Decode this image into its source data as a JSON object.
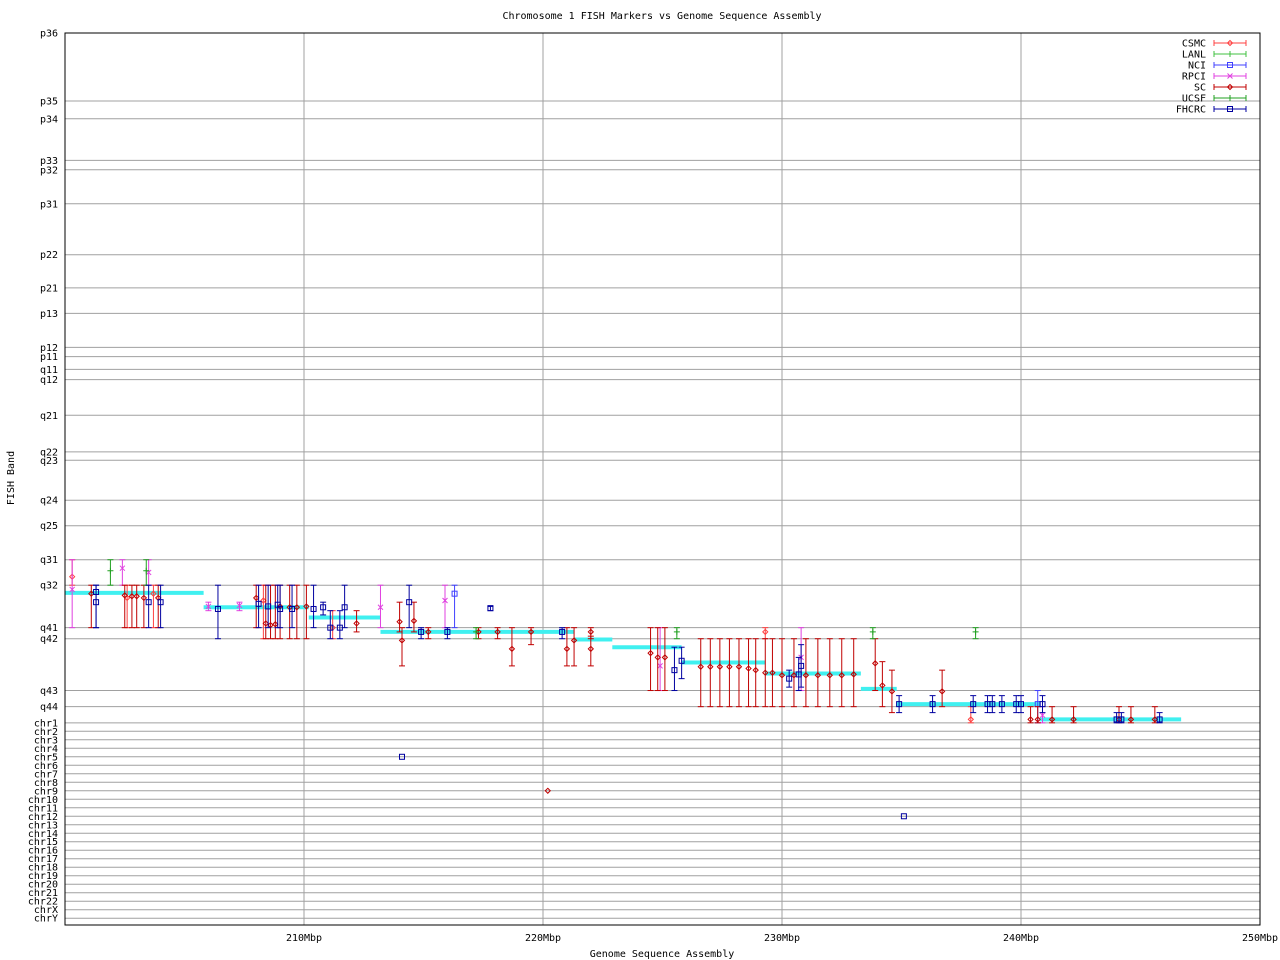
{
  "chart_data": {
    "type": "scatter",
    "title": "Chromosome 1 FISH Markers vs Genome Sequence Assembly",
    "xlabel": "Genome Sequence Assembly",
    "ylabel": "FISH Band",
    "xlim": [
      200,
      250
    ],
    "x_ticks": [
      {
        "value": 210,
        "label": "210Mbp"
      },
      {
        "value": 220,
        "label": "220Mbp"
      },
      {
        "value": 230,
        "label": "230Mbp"
      },
      {
        "value": 240,
        "label": "240Mbp"
      },
      {
        "value": 250,
        "label": "250Mbp"
      }
    ],
    "y_categories": [
      {
        "label": "p36",
        "pos": 0
      },
      {
        "label": "p35",
        "pos": 8.0
      },
      {
        "label": "p34",
        "pos": 10.1
      },
      {
        "label": "p33",
        "pos": 15.0
      },
      {
        "label": "p32",
        "pos": 16.1
      },
      {
        "label": "p31",
        "pos": 20.1
      },
      {
        "label": "p22",
        "pos": 26.1
      },
      {
        "label": "p21",
        "pos": 30.0
      },
      {
        "label": "p13",
        "pos": 33.0
      },
      {
        "label": "p12",
        "pos": 37.0
      },
      {
        "label": "p11",
        "pos": 38.1
      },
      {
        "label": "q11",
        "pos": 39.6
      },
      {
        "label": "q12",
        "pos": 40.8
      },
      {
        "label": "q21",
        "pos": 45.0
      },
      {
        "label": "q22",
        "pos": 49.3
      },
      {
        "label": "q23",
        "pos": 50.3
      },
      {
        "label": "q24",
        "pos": 55.0
      },
      {
        "label": "q25",
        "pos": 58.0
      },
      {
        "label": "q31",
        "pos": 62.0
      },
      {
        "label": "q32",
        "pos": 65.0
      },
      {
        "label": "q41",
        "pos": 70.0
      },
      {
        "label": "q42",
        "pos": 71.3
      },
      {
        "label": "q43",
        "pos": 77.4
      },
      {
        "label": "q44",
        "pos": 79.3
      },
      {
        "label": "chr1",
        "pos": 81.2
      },
      {
        "label": "chr2",
        "pos": 82.2
      },
      {
        "label": "chr3",
        "pos": 83.2
      },
      {
        "label": "chr4",
        "pos": 84.2
      },
      {
        "label": "chr5",
        "pos": 85.2
      },
      {
        "label": "chr6",
        "pos": 86.2
      },
      {
        "label": "chr7",
        "pos": 87.2
      },
      {
        "label": "chr8",
        "pos": 88.2
      },
      {
        "label": "chr9",
        "pos": 89.2
      },
      {
        "label": "chr10",
        "pos": 90.2
      },
      {
        "label": "chr11",
        "pos": 91.2
      },
      {
        "label": "chr12",
        "pos": 92.2
      },
      {
        "label": "chr13",
        "pos": 93.2
      },
      {
        "label": "chr14",
        "pos": 94.2
      },
      {
        "label": "chr15",
        "pos": 95.2
      },
      {
        "label": "chr16",
        "pos": 96.2
      },
      {
        "label": "chr17",
        "pos": 97.2
      },
      {
        "label": "chr18",
        "pos": 98.2
      },
      {
        "label": "chr19",
        "pos": 99.2
      },
      {
        "label": "chr20",
        "pos": 100.2
      },
      {
        "label": "chr21",
        "pos": 101.2
      },
      {
        "label": "chr22",
        "pos": 102.2
      },
      {
        "label": "chrX",
        "pos": 103.2
      },
      {
        "label": "chrY",
        "pos": 104.2
      }
    ],
    "ylim": [
      0,
      105
    ],
    "grid": true,
    "legend_position": "top-right",
    "assembly_segments": [
      {
        "x0": 200.0,
        "x1": 205.8,
        "y": 65.9
      },
      {
        "x0": 205.8,
        "x1": 210.2,
        "y": 67.6
      },
      {
        "x0": 210.2,
        "x1": 213.2,
        "y": 68.8
      },
      {
        "x0": 213.2,
        "x1": 221.3,
        "y": 70.5
      },
      {
        "x0": 221.3,
        "x1": 222.9,
        "y": 71.4
      },
      {
        "x0": 222.9,
        "x1": 225.8,
        "y": 72.3
      },
      {
        "x0": 225.8,
        "x1": 229.3,
        "y": 74.1
      },
      {
        "x0": 229.3,
        "x1": 233.3,
        "y": 75.4
      },
      {
        "x0": 233.3,
        "x1": 234.8,
        "y": 77.2
      },
      {
        "x0": 234.8,
        "x1": 240.8,
        "y": 79.0
      },
      {
        "x0": 240.8,
        "x1": 246.7,
        "y": 80.8
      }
    ],
    "series": [
      {
        "name": "CSMC",
        "color": "#ff4040",
        "marker": "diamond",
        "points": [
          [
            200.3,
            64.0,
            62.0,
            65.0
          ],
          [
            202.6,
            66.5,
            65.0,
            70.0
          ],
          [
            203.7,
            66.0,
            65.0,
            70.0
          ],
          [
            208.3,
            66.8,
            65.0,
            71.3
          ],
          [
            211.2,
            70.0,
            68.0,
            71.3
          ],
          [
            229.3,
            70.5,
            70.0,
            71.3
          ],
          [
            237.9,
            80.8,
            79.3,
            81.2
          ]
        ]
      },
      {
        "name": "LANL",
        "color": "#40c040",
        "marker": "plus",
        "points": []
      },
      {
        "name": "NCI",
        "color": "#4040ff",
        "marker": "square",
        "points": [
          [
            216.3,
            66.0,
            65.0,
            70.0
          ],
          [
            240.7,
            79.0,
            77.4,
            81.2
          ]
        ]
      },
      {
        "name": "RPCI",
        "color": "#e040e0",
        "marker": "cross",
        "points": [
          [
            200.3,
            65.5,
            62.0,
            70.0
          ],
          [
            202.4,
            63.0,
            62.0,
            65.0
          ],
          [
            203.5,
            63.5,
            62.0,
            65.0
          ],
          [
            206.0,
            67.5,
            67.0,
            68.0
          ],
          [
            207.3,
            67.4,
            67.0,
            68.0
          ],
          [
            213.2,
            67.6,
            65.0,
            70.0
          ],
          [
            215.9,
            66.8,
            65.0,
            70.0
          ],
          [
            224.9,
            74.5,
            70.0,
            77.4
          ],
          [
            230.8,
            73.5,
            70.0,
            77.4
          ],
          [
            240.9,
            80.3,
            79.3,
            81.2
          ]
        ]
      },
      {
        "name": "SC",
        "color": "#c00000",
        "marker": "diamond",
        "points": [
          [
            201.1,
            66.0,
            65.0,
            70.0
          ],
          [
            202.5,
            66.2,
            65.0,
            70.0
          ],
          [
            202.8,
            66.3,
            65.0,
            70.0
          ],
          [
            203.0,
            66.3,
            65.0,
            70.0
          ],
          [
            203.3,
            66.5,
            65.0,
            70.0
          ],
          [
            203.9,
            66.5,
            65.0,
            70.0
          ],
          [
            208.0,
            66.5,
            65.0,
            70.0
          ],
          [
            208.4,
            69.5,
            65.0,
            71.3
          ],
          [
            208.6,
            69.7,
            65.0,
            71.3
          ],
          [
            208.8,
            69.6,
            65.0,
            71.3
          ],
          [
            209.0,
            67.5,
            65.0,
            71.3
          ],
          [
            209.4,
            67.6,
            65.0,
            71.3
          ],
          [
            209.7,
            67.6,
            65.0,
            71.3
          ],
          [
            210.1,
            67.5,
            65.0,
            71.3
          ],
          [
            212.2,
            69.5,
            68.0,
            70.5
          ],
          [
            214.0,
            69.3,
            67.0,
            70.5
          ],
          [
            214.1,
            71.5,
            70.0,
            74.5
          ],
          [
            214.6,
            69.2,
            67.0,
            70.5
          ],
          [
            215.2,
            70.5,
            70.0,
            71.3
          ],
          [
            217.3,
            70.5,
            70.0,
            71.3
          ],
          [
            218.1,
            70.5,
            70.0,
            71.3
          ],
          [
            218.7,
            72.5,
            70.0,
            74.5
          ],
          [
            219.5,
            70.5,
            70.0,
            72.0
          ],
          [
            221.0,
            72.5,
            70.0,
            74.5
          ],
          [
            221.3,
            71.5,
            70.0,
            74.5
          ],
          [
            222.0,
            70.5,
            70.0,
            71.3
          ],
          [
            222.0,
            72.5,
            71.0,
            74.5
          ],
          [
            224.5,
            73.0,
            70.0,
            77.4
          ],
          [
            224.8,
            73.5,
            70.0,
            77.4
          ],
          [
            225.1,
            73.5,
            70.0,
            77.4
          ],
          [
            226.6,
            74.6,
            71.3,
            79.3
          ],
          [
            227.0,
            74.6,
            71.3,
            79.3
          ],
          [
            227.4,
            74.6,
            71.3,
            79.3
          ],
          [
            227.8,
            74.6,
            71.3,
            79.3
          ],
          [
            228.2,
            74.6,
            71.3,
            79.3
          ],
          [
            228.6,
            74.8,
            71.3,
            79.3
          ],
          [
            228.9,
            75.0,
            71.3,
            79.3
          ],
          [
            229.3,
            75.3,
            71.3,
            79.3
          ],
          [
            229.6,
            75.3,
            71.3,
            79.3
          ],
          [
            230.0,
            75.6,
            71.3,
            79.3
          ],
          [
            230.5,
            75.6,
            71.3,
            79.3
          ],
          [
            231.0,
            75.6,
            71.3,
            79.3
          ],
          [
            231.5,
            75.6,
            71.3,
            79.3
          ],
          [
            232.0,
            75.6,
            71.3,
            79.3
          ],
          [
            232.5,
            75.6,
            71.3,
            79.3
          ],
          [
            233.0,
            75.5,
            71.3,
            79.3
          ],
          [
            233.9,
            74.2,
            71.3,
            77.4
          ],
          [
            234.2,
            76.8,
            74.0,
            79.3
          ],
          [
            234.6,
            77.5,
            75.0,
            80.0
          ],
          [
            236.7,
            77.5,
            75.0,
            79.3
          ],
          [
            240.4,
            80.8,
            79.3,
            81.2
          ],
          [
            240.7,
            80.8,
            79.3,
            81.2
          ],
          [
            241.3,
            80.8,
            79.3,
            81.2
          ],
          [
            242.2,
            80.8,
            79.3,
            81.2
          ],
          [
            244.1,
            80.8,
            79.3,
            81.2
          ],
          [
            244.6,
            80.8,
            79.3,
            81.2
          ],
          [
            245.6,
            80.8,
            79.3,
            81.2
          ],
          [
            220.2,
            89.2,
            89.2,
            89.2
          ]
        ]
      },
      {
        "name": "UCSF",
        "color": "#20a020",
        "marker": "plus",
        "points": [
          [
            201.9,
            63.3,
            62.0,
            65.0
          ],
          [
            203.4,
            63.3,
            62.0,
            65.0
          ],
          [
            217.2,
            70.5,
            70.0,
            71.3
          ],
          [
            225.6,
            70.5,
            70.0,
            71.3
          ],
          [
            233.8,
            70.5,
            70.0,
            71.3
          ],
          [
            238.1,
            70.5,
            70.0,
            71.3
          ]
        ]
      },
      {
        "name": "FHCRC",
        "color": "#0000a0",
        "marker": "square",
        "points": [
          [
            201.3,
            67.0,
            65.0,
            70.0
          ],
          [
            201.3,
            65.8,
            65.0,
            70.0
          ],
          [
            203.5,
            67.0,
            65.0,
            70.0
          ],
          [
            204.0,
            67.0,
            65.0,
            70.0
          ],
          [
            206.4,
            67.8,
            65.0,
            71.3
          ],
          [
            208.1,
            67.2,
            65.0,
            70.0
          ],
          [
            208.5,
            67.5,
            65.0,
            70.0
          ],
          [
            208.9,
            67.3,
            65.0,
            70.0
          ],
          [
            209.0,
            67.8,
            65.0,
            70.0
          ],
          [
            209.5,
            67.8,
            65.0,
            70.0
          ],
          [
            210.4,
            67.8,
            65.0,
            70.0
          ],
          [
            210.8,
            67.6,
            67.0,
            68.5
          ],
          [
            211.1,
            70.0,
            68.0,
            71.3
          ],
          [
            211.5,
            70.0,
            68.0,
            71.3
          ],
          [
            211.7,
            67.6,
            65.0,
            70.0
          ],
          [
            214.4,
            67.0,
            65.0,
            70.0
          ],
          [
            214.9,
            70.5,
            70.0,
            71.3
          ],
          [
            216.0,
            70.5,
            70.0,
            71.3
          ],
          [
            217.8,
            67.7,
            67.5,
            68.0
          ],
          [
            220.8,
            70.5,
            70.0,
            71.3
          ],
          [
            225.5,
            75.0,
            72.3,
            77.4
          ],
          [
            225.8,
            73.9,
            72.3,
            76.0
          ],
          [
            230.3,
            76.0,
            75.0,
            77.0
          ],
          [
            230.7,
            75.5,
            73.5,
            77.4
          ],
          [
            230.8,
            74.5,
            72.0,
            77.0
          ],
          [
            234.9,
            79.0,
            78.0,
            80.0
          ],
          [
            236.3,
            79.0,
            78.0,
            80.0
          ],
          [
            238.0,
            79.0,
            78.0,
            80.0
          ],
          [
            238.6,
            79.0,
            78.0,
            80.0
          ],
          [
            238.8,
            79.0,
            78.0,
            80.0
          ],
          [
            239.2,
            79.0,
            78.0,
            80.0
          ],
          [
            239.8,
            79.0,
            78.0,
            80.0
          ],
          [
            240.0,
            79.0,
            78.0,
            80.0
          ],
          [
            240.9,
            79.0,
            78.0,
            80.0
          ],
          [
            244.0,
            80.8,
            80.0,
            81.2
          ],
          [
            244.2,
            80.8,
            80.0,
            81.2
          ],
          [
            245.8,
            80.8,
            80.0,
            81.2
          ],
          [
            214.1,
            85.2,
            85.2,
            85.2
          ],
          [
            235.1,
            92.2,
            92.2,
            92.2
          ]
        ]
      }
    ]
  }
}
